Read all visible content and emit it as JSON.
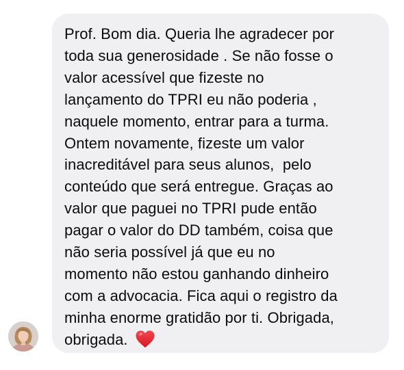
{
  "message": {
    "lines": [
      "Prof. Bom dia. Queria lhe agradecer por",
      "toda sua generosidade . Se não fosse o",
      "valor acessível que fizeste no",
      "lançamento do TPRI eu não poderia ,",
      "naquele momento, entrar para a turma.",
      "Ontem novamente, fizeste um valor",
      "inacreditável para seus alunos,  pelo",
      "conteúdo que será entregue. Graças ao",
      "valor que paguei no TPRI pude então",
      "pagar o valor do DD também, coisa que",
      "não seria possível já que eu no",
      "momento não estou ganhando dinheiro",
      "com a advocacia. Fica aqui o registro da",
      "minha enorme gratidão por ti. Obrigada,",
      "obrigada. "
    ],
    "emoji_icon": "red-heart-icon"
  },
  "colors": {
    "bubble_background": "#f0f0f2",
    "text": "#0b0b0b",
    "heart": "#e3202b"
  },
  "avatar": {
    "icon": "user-avatar"
  }
}
